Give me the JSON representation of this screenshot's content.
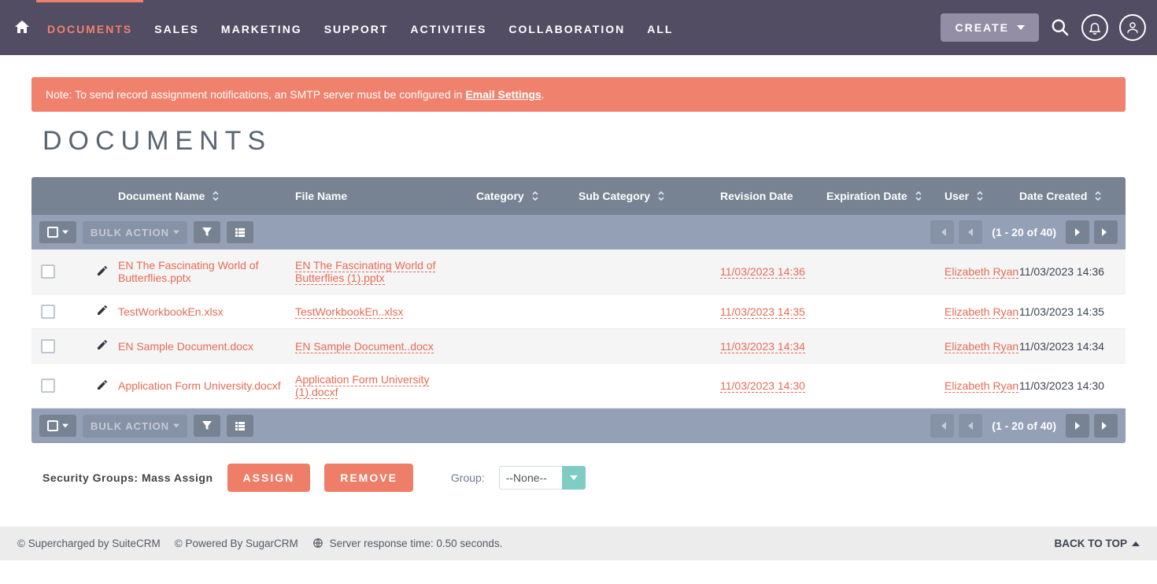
{
  "nav": {
    "items": [
      "DOCUMENTS",
      "SALES",
      "MARKETING",
      "SUPPORT",
      "ACTIVITIES",
      "COLLABORATION",
      "ALL"
    ],
    "active_index": 0,
    "create_label": "CREATE"
  },
  "alert": {
    "prefix": "Note: To send record assignment notifications, an SMTP server must be configured in ",
    "link_text": "Email Settings",
    "suffix": "."
  },
  "page_title": "DOCUMENTS",
  "columns": [
    {
      "label": "Document Name",
      "sortable": true
    },
    {
      "label": "File Name",
      "sortable": false
    },
    {
      "label": "Category",
      "sortable": true
    },
    {
      "label": "Sub Category",
      "sortable": true
    },
    {
      "label": "Revision Date",
      "sortable": false
    },
    {
      "label": "Expiration Date",
      "sortable": true
    },
    {
      "label": "User",
      "sortable": true
    },
    {
      "label": "Date Created",
      "sortable": true
    }
  ],
  "toolbar": {
    "bulk_action_label": "BULK ACTION",
    "range_text": "(1 - 20 of 40)"
  },
  "rows": [
    {
      "doc": "EN The Fascinating World of Butterflies.pptx",
      "file": "EN The Fascinating World of Butterflies (1).pptx",
      "category": "",
      "sub": "",
      "rev": "11/03/2023 14:36",
      "exp": "",
      "user": "Elizabeth Ryan",
      "created": "11/03/2023 14:36"
    },
    {
      "doc": "TestWorkbookEn.xlsx",
      "file": "TestWorkbookEn..xlsx",
      "category": "",
      "sub": "",
      "rev": "11/03/2023 14:35",
      "exp": "",
      "user": "Elizabeth Ryan",
      "created": "11/03/2023 14:35"
    },
    {
      "doc": "EN Sample Document.docx",
      "file": "EN Sample Document..docx",
      "category": "",
      "sub": "",
      "rev": "11/03/2023 14:34",
      "exp": "",
      "user": "Elizabeth Ryan",
      "created": "11/03/2023 14:34"
    },
    {
      "doc": "Application Form University.docxf",
      "file": "Application Form University (1).docxf",
      "category": "",
      "sub": "",
      "rev": "11/03/2023 14:30",
      "exp": "",
      "user": "Elizabeth Ryan",
      "created": "11/03/2023 14:30"
    }
  ],
  "mass_assign": {
    "title": "Security Groups: Mass Assign",
    "assign_label": "ASSIGN",
    "remove_label": "REMOVE",
    "group_label": "Group:",
    "group_value": "--None--"
  },
  "footer": {
    "supercharged": "© Supercharged by SuiteCRM",
    "powered": "© Powered By SugarCRM",
    "response": "Server response time: 0.50 seconds.",
    "back_top": "BACK TO TOP"
  }
}
